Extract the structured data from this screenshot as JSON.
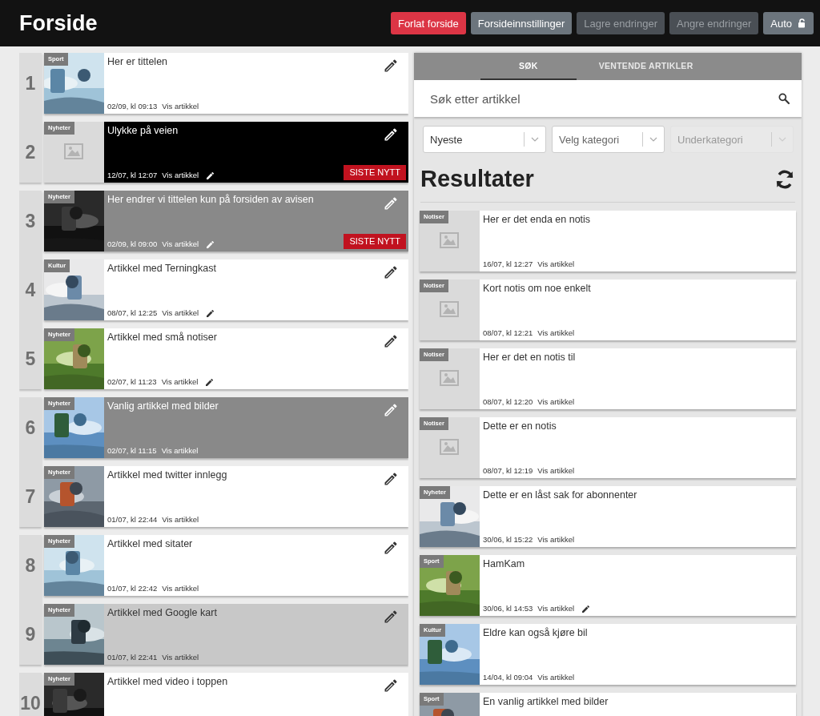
{
  "header": {
    "title": "Forside",
    "buttons": [
      {
        "label": "Forlat forside",
        "kind": "danger",
        "disabled": false
      },
      {
        "label": "Forsideinnstillinger",
        "kind": "secondary",
        "disabled": false
      },
      {
        "label": "Lagre endringer",
        "kind": "secondary",
        "disabled": true
      },
      {
        "label": "Angre endringer",
        "kind": "secondary",
        "disabled": true
      },
      {
        "label": "Auto",
        "kind": "lock",
        "disabled": false
      }
    ]
  },
  "frontpage": {
    "groups": [
      {
        "slots": [
          {
            "number": "1",
            "card": {
              "kind": "picture",
              "category": "Sport",
              "title": "Her er tittelen",
              "date": "02/09, kl 09:13",
              "link": "Vis artikkel",
              "edited": false,
              "color": "#ffffff"
            }
          },
          {
            "number": "2",
            "card": {
              "kind": "placeholder",
              "category": "Nyheter",
              "title": "Ulykke på veien",
              "date": "12/07, kl 12:07",
              "link": "Vis artikkel",
              "edited": true,
              "color": "#000000",
              "badge": "SISTE NYTT"
            }
          }
        ]
      },
      {
        "slots": [
          {
            "number": "3",
            "card": {
              "kind": "picture",
              "category": "Nyheter",
              "title": "Her endrer vi tittelen kun på forsiden av avisen",
              "date": "02/09, kl 09:00",
              "link": "Vis artikkel",
              "edited": true,
              "color": "#898989",
              "badge": "SISTE NYTT"
            }
          },
          {
            "number": "4",
            "card": {
              "kind": "picture",
              "category": "Kultur",
              "title": "Artikkel med Terningkast",
              "date": "08/07, kl 12:25",
              "link": "Vis artikkel",
              "edited": true,
              "color": "#ffffff"
            }
          },
          {
            "number": "5",
            "card": {
              "kind": "picture",
              "category": "Nyheter",
              "title": "Artikkel med små notiser",
              "date": "02/07, kl 11:23",
              "link": "Vis artikkel",
              "edited": true,
              "color": "#ffffff"
            }
          }
        ]
      },
      {
        "slots": [
          {
            "number": "6",
            "card": {
              "kind": "picture",
              "category": "Nyheter",
              "title": "Vanlig artikkel med bilder",
              "date": "02/07, kl 11:15",
              "link": "Vis artikkel",
              "edited": false,
              "color": "#898989"
            }
          },
          {
            "number": "7",
            "card": {
              "kind": "picture",
              "category": "Nyheter",
              "title": "Artikkel med twitter innlegg",
              "date": "01/07, kl 22:44",
              "link": "Vis artikkel",
              "edited": false,
              "color": "#ffffff"
            }
          }
        ]
      },
      {
        "slots": [
          {
            "number": "8",
            "card": {
              "kind": "picture",
              "category": "Nyheter",
              "title": "Artikkel med sitater",
              "date": "01/07, kl 22:42",
              "link": "Vis artikkel",
              "edited": false,
              "color": "#ffffff"
            }
          },
          {
            "number": "9",
            "card": {
              "kind": "picture",
              "category": "Nyheter",
              "title": "Artikkel med Google kart",
              "date": "01/07, kl 22:41",
              "link": "Vis artikkel",
              "edited": false,
              "color": "#c8c8c8"
            }
          }
        ]
      },
      {
        "slots": [
          {
            "number": "10",
            "card": {
              "kind": "picture",
              "category": "Nyheter",
              "title": "Artikkel med video i toppen",
              "color": "#ffffff"
            }
          }
        ]
      }
    ]
  },
  "search_panel": {
    "tabs": [
      {
        "label": "SØK",
        "selected": true
      },
      {
        "label": "VENTENDE ARTIKLER",
        "selected": false
      }
    ],
    "search": {
      "placeholder": "Søk etter artikkel"
    },
    "filters": [
      {
        "value": "Nyeste",
        "disabled": false
      },
      {
        "placeholder": "Velg kategori",
        "disabled": false
      },
      {
        "placeholder": "Underkategori",
        "disabled": true
      }
    ],
    "results_title": "Resultater",
    "results": [
      {
        "kind": "placeholder",
        "category": "Notiser",
        "title": "Her er det enda en notis",
        "date": "16/07, kl 12:27",
        "link": "Vis artikkel",
        "edited": false
      },
      {
        "kind": "placeholder",
        "category": "Notiser",
        "title": "Kort notis om noe enkelt",
        "date": "08/07, kl 12:21",
        "link": "Vis artikkel",
        "edited": false
      },
      {
        "kind": "placeholder",
        "category": "Notiser",
        "title": "Her er det en notis til",
        "date": "08/07, kl 12:20",
        "link": "Vis artikkel",
        "edited": false
      },
      {
        "kind": "placeholder",
        "category": "Notiser",
        "title": "Dette er en notis",
        "date": "08/07, kl 12:19",
        "link": "Vis artikkel",
        "edited": false
      },
      {
        "kind": "picture",
        "category": "Nyheter",
        "title": "Dette er en låst sak for abonnenter",
        "date": "30/06, kl 15:22",
        "link": "Vis artikkel",
        "edited": false
      },
      {
        "kind": "picture",
        "category": "Sport",
        "title": "HamKam",
        "date": "30/06, kl 14:53",
        "link": "Vis artikkel",
        "edited": true
      },
      {
        "kind": "picture",
        "category": "Kultur",
        "title": "Eldre kan også kjøre bil",
        "date": "14/04, kl 09:04",
        "link": "Vis artikkel",
        "edited": false
      },
      {
        "kind": "picture",
        "category": "Sport",
        "title": "En vanlig artikkel med bilder"
      }
    ]
  }
}
